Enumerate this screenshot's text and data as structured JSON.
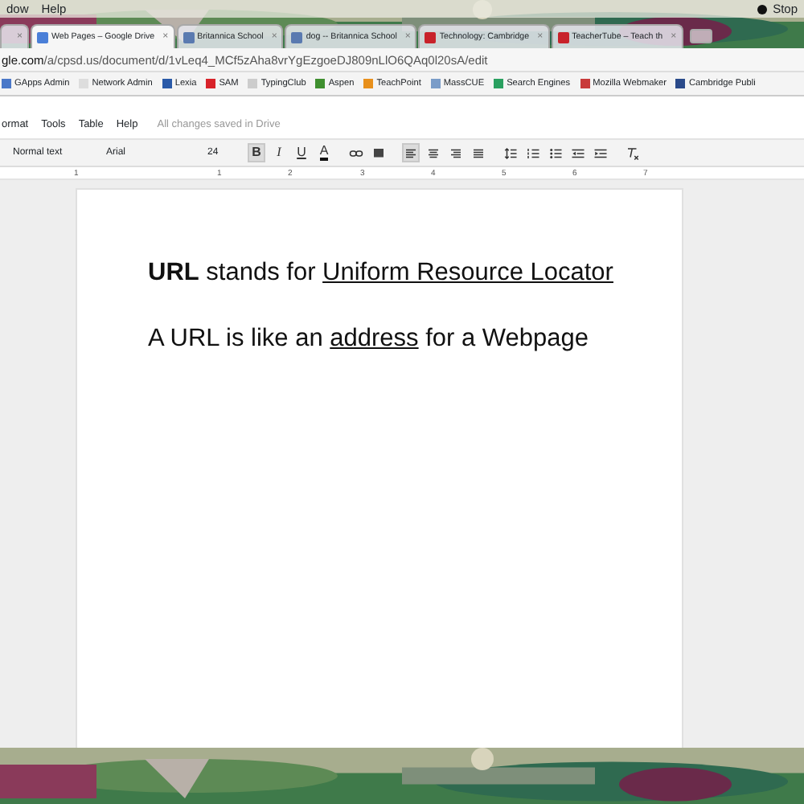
{
  "menubar": {
    "items": [
      "dow",
      "Help"
    ],
    "status": "Stop"
  },
  "tabs": [
    {
      "close": "×",
      "selected": false
    },
    {
      "label": "Web Pages – Google Drive",
      "close": "×",
      "selected": true
    },
    {
      "label": "Britannica School",
      "close": "×",
      "selected": false
    },
    {
      "label": "dog -- Britannica School",
      "close": "×",
      "selected": false
    },
    {
      "label": "Technology: Cambridge",
      "close": "×",
      "selected": false
    },
    {
      "label": "TeacherTube – Teach th",
      "close": "×",
      "selected": false
    }
  ],
  "address": {
    "host": "gle.com",
    "path": "/a/cpsd.us/document/d/1vLeq4_MCf5zAha8vrYgEzgoeDJ809nLlO6QAq0l20sA/edit"
  },
  "bookmarks": [
    {
      "label": "GApps Admin",
      "color": "#4a78c8"
    },
    {
      "label": "Network Admin",
      "color": "#dddddd"
    },
    {
      "label": "Lexia",
      "color": "#2a5aa8"
    },
    {
      "label": "SAM",
      "color": "#d8232a"
    },
    {
      "label": "TypingClub",
      "color": "#cccccc"
    },
    {
      "label": "Aspen",
      "color": "#3f8f2f"
    },
    {
      "label": "TeachPoint",
      "color": "#e8901c"
    },
    {
      "label": "MassCUE",
      "color": "#7a9cc8"
    },
    {
      "label": "Search Engines",
      "color": "#2aa060"
    },
    {
      "label": "Mozilla Webmaker",
      "color": "#c83a3a"
    },
    {
      "label": "Cambridge Publi",
      "color": "#2a4a8a"
    }
  ],
  "docs_menu": {
    "items": [
      "ormat",
      "Tools",
      "Table",
      "Help"
    ],
    "save_status": "All changes saved in Drive"
  },
  "toolbar": {
    "style": "Normal text",
    "font": "Arial",
    "size": "24",
    "buttons": [
      {
        "kind": "bold",
        "label": "B",
        "selected": true
      },
      {
        "kind": "italic",
        "label": "I",
        "selected": false
      },
      {
        "kind": "underline",
        "label": "U",
        "selected": false
      },
      {
        "kind": "color",
        "label": "A",
        "selected": false
      },
      {
        "kind": "link",
        "selected": false
      },
      {
        "kind": "comment",
        "selected": false
      },
      {
        "kind": "left",
        "selected": true
      },
      {
        "kind": "center",
        "selected": false
      },
      {
        "kind": "right",
        "selected": false
      },
      {
        "kind": "justify",
        "selected": false
      },
      {
        "kind": "spacing",
        "selected": false
      },
      {
        "kind": "numbered",
        "selected": false
      },
      {
        "kind": "bulleted",
        "selected": false
      },
      {
        "kind": "outdent",
        "selected": false
      },
      {
        "kind": "indent",
        "selected": false
      },
      {
        "kind": "clear",
        "selected": false
      }
    ]
  },
  "ruler": [
    "1",
    "1",
    "2",
    "3",
    "4",
    "5",
    "6",
    "7"
  ],
  "document": {
    "paragraphs": [
      [
        {
          "text": "URL",
          "bold": true,
          "underline": false
        },
        {
          "text": " stands for ",
          "bold": false,
          "underline": false
        },
        {
          "text": "Uniform Resource Locator",
          "bold": false,
          "underline": true
        }
      ],
      [
        {
          "text": "A URL is like an ",
          "bold": false,
          "underline": false
        },
        {
          "text": "address",
          "bold": false,
          "underline": true
        },
        {
          "text": " for a Webpage",
          "bold": false,
          "underline": false
        }
      ]
    ]
  }
}
